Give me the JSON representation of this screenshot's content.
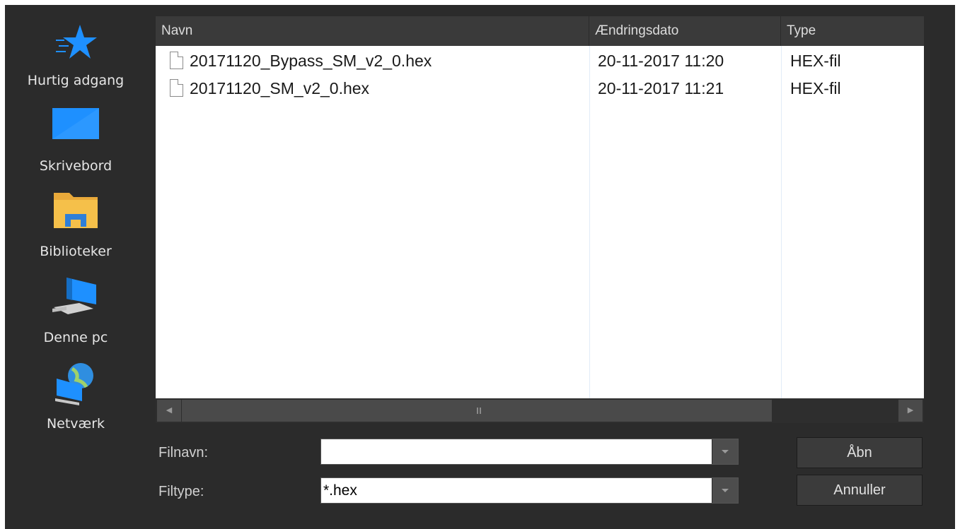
{
  "places": [
    {
      "icon": "star-icon",
      "label": "Hurtig adgang"
    },
    {
      "icon": "desktop-icon",
      "label": "Skrivebord"
    },
    {
      "icon": "folder-icon",
      "label": "Biblioteker"
    },
    {
      "icon": "computer-icon",
      "label": "Denne pc"
    },
    {
      "icon": "network-globe-icon",
      "label": "Netværk"
    }
  ],
  "columns": {
    "name": "Navn",
    "date": "Ændringsdato",
    "type": "Type"
  },
  "files": [
    {
      "name": "20171120_Bypass_SM_v2_0.hex",
      "date": "20-11-2017 11:20",
      "type": "HEX-fil"
    },
    {
      "name": "20171120_SM_v2_0.hex",
      "date": "20-11-2017 11:21",
      "type": "HEX-fil"
    }
  ],
  "fields": {
    "filename_label": "Filnavn:",
    "filename_value": "",
    "filetype_label": "Filtype:",
    "filetype_value": "*.hex"
  },
  "buttons": {
    "open": "Åbn",
    "cancel": "Annuller"
  },
  "colors": {
    "dialog_bg": "#2b2b2b",
    "accent_blue": "#1e90ff",
    "folder_yellow": "#f5c04a"
  }
}
